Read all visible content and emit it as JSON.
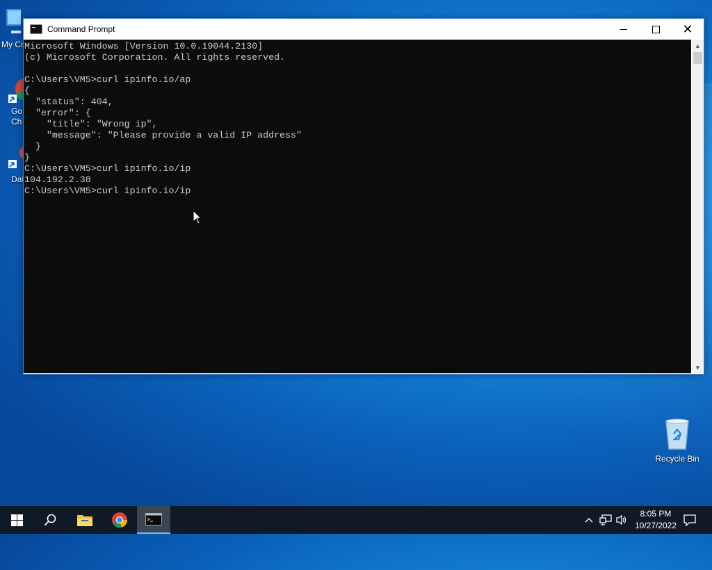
{
  "desktop": {
    "icons": [
      {
        "label": "My Co",
        "icon": "computer-icon"
      },
      {
        "label": "Go\nCh",
        "icon": "chrome-shortcut-icon"
      },
      {
        "label": "DataV",
        "icon": "app-shortcut-icon"
      }
    ],
    "recycle_bin": {
      "label": "Recycle Bin",
      "icon": "recycle-bin-icon"
    }
  },
  "window": {
    "title": "Command Prompt",
    "icon": "cmd-icon",
    "controls": {
      "minimize": "minimize-icon",
      "maximize": "maximize-icon",
      "close": "close-icon"
    }
  },
  "console": {
    "lines": [
      "Microsoft Windows [Version 10.0.19044.2130]",
      "(c) Microsoft Corporation. All rights reserved.",
      "",
      "C:\\Users\\VM5>curl ipinfo.io/ap",
      "{",
      "  \"status\": 404,",
      "  \"error\": {",
      "    \"title\": \"Wrong ip\",",
      "    \"message\": \"Please provide a valid IP address\"",
      "  }",
      "}",
      "C:\\Users\\VM5>curl ipinfo.io/ip",
      "104.192.2.38",
      "C:\\Users\\VM5>curl ipinfo.io/ip"
    ]
  },
  "taskbar": {
    "items": [
      {
        "name": "start",
        "icon": "windows-start-icon"
      },
      {
        "name": "search",
        "icon": "search-icon"
      },
      {
        "name": "file-explorer",
        "icon": "folder-icon"
      },
      {
        "name": "chrome",
        "icon": "chrome-icon"
      },
      {
        "name": "command-prompt",
        "icon": "cmd-icon",
        "active": true
      }
    ],
    "tray": {
      "icons": [
        "chevron-up-icon",
        "network-icon",
        "volume-icon"
      ],
      "time": "8:05 PM",
      "date": "10/27/2022",
      "notification_icon": "notification-icon"
    }
  }
}
